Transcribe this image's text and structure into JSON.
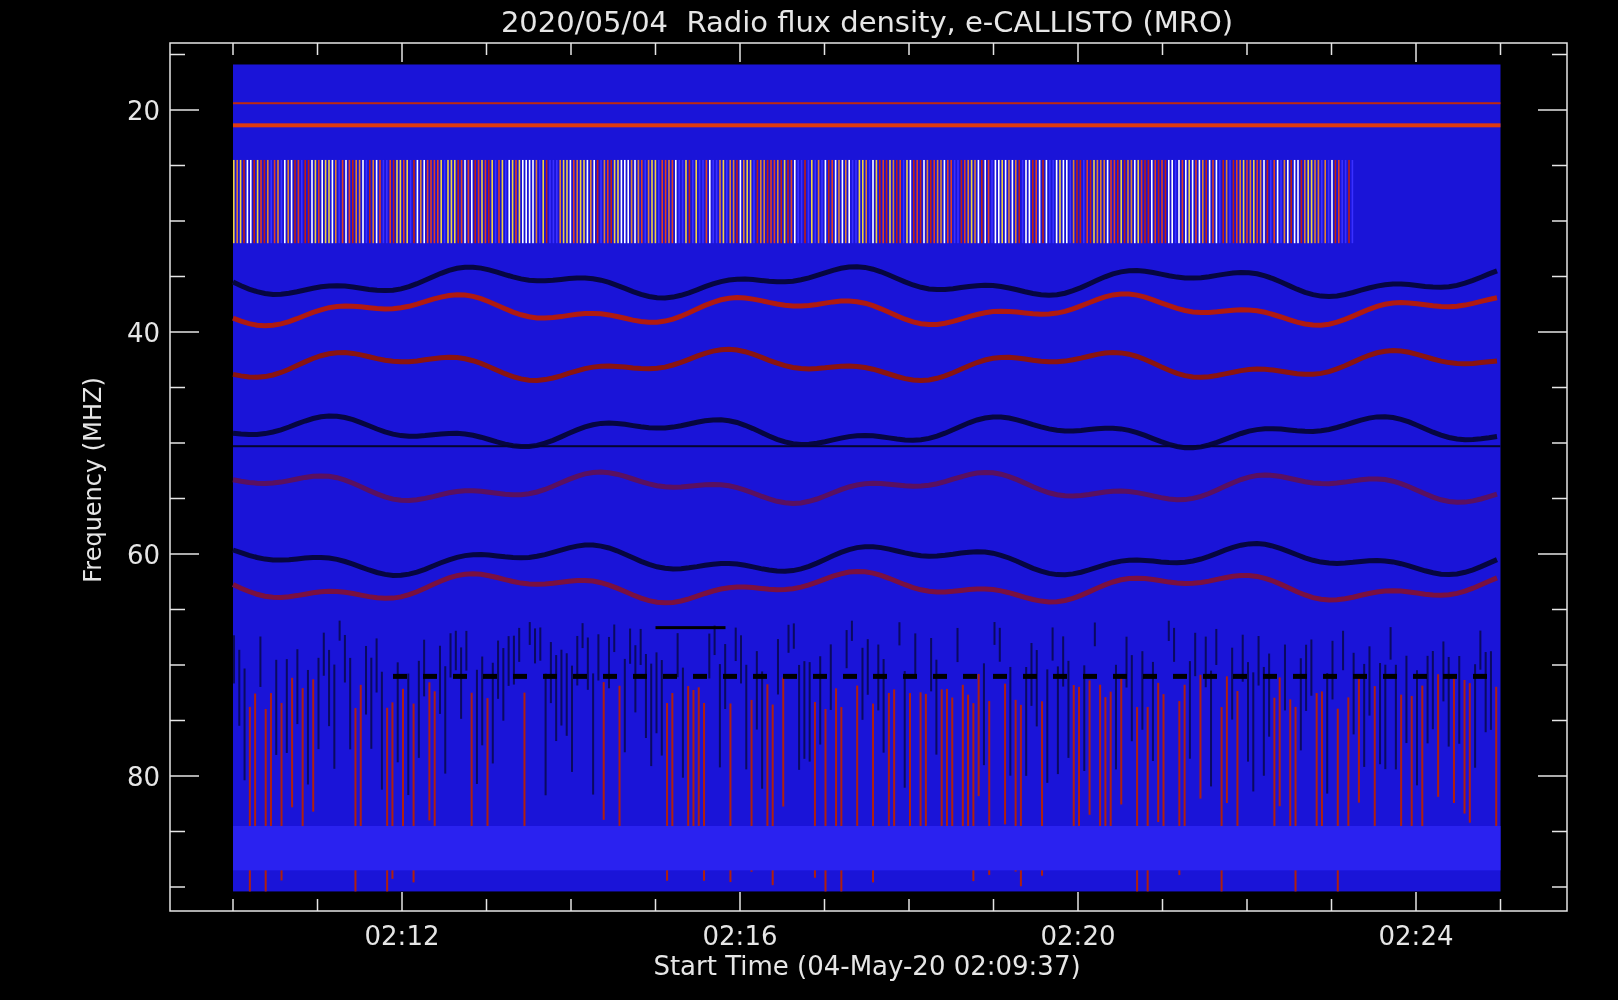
{
  "title": "2020/05/04  Radio flux density, e-CALLISTO (MRO)",
  "y_axis": {
    "label": "Frequency (MHZ)",
    "ticks": [
      "20",
      "40",
      "60",
      "80"
    ]
  },
  "x_axis": {
    "label": "Start Time (04-May-20 02:09:37)",
    "ticks": [
      "02:12",
      "02:16",
      "02:20",
      "02:24"
    ]
  }
}
